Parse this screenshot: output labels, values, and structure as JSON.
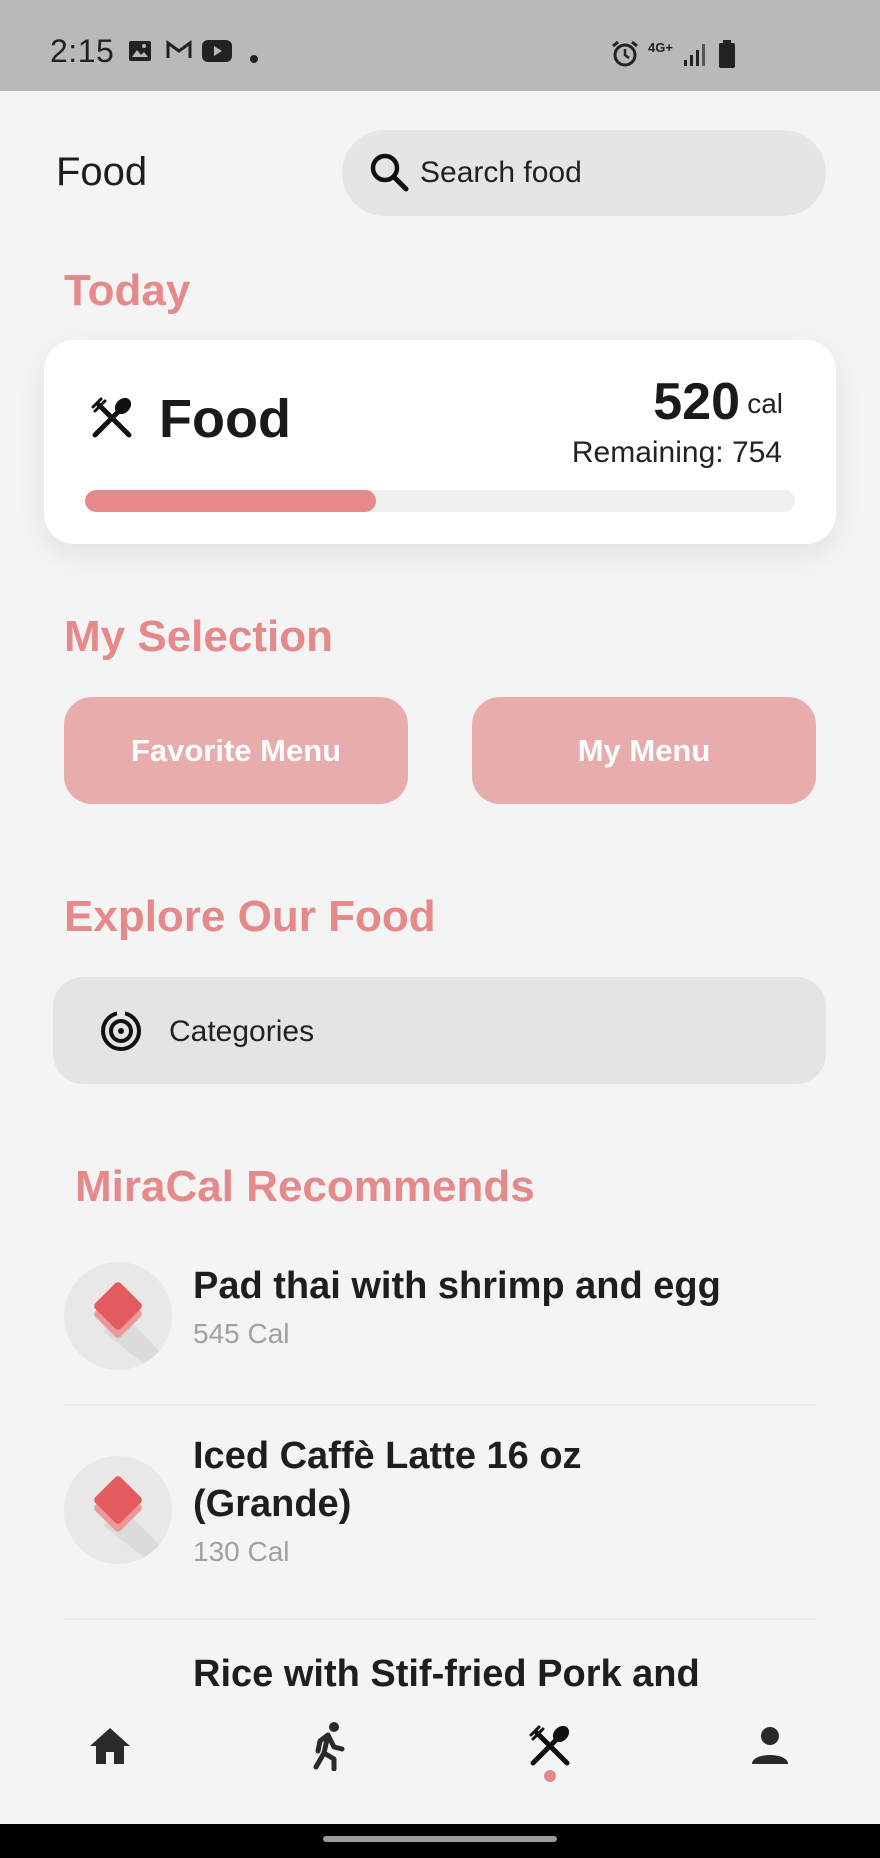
{
  "status_bar": {
    "time": "2:15",
    "left_icons": [
      "image-icon",
      "gmail-icon",
      "youtube-icon",
      "dot-icon"
    ],
    "right_icons": [
      "alarm-icon",
      "4g-icon",
      "signal-icon",
      "battery-icon"
    ],
    "network": "4G+"
  },
  "header": {
    "title": "Food",
    "search_placeholder": "Search food"
  },
  "today": {
    "title": "Today",
    "card": {
      "label": "Food",
      "calories": "520",
      "unit": "cal",
      "remaining": "Remaining: 754",
      "progress_fraction": 0.41
    }
  },
  "my_selection": {
    "title": "My Selection",
    "favorite_label": "Favorite Menu",
    "my_menu_label": "My Menu"
  },
  "explore": {
    "title": "Explore Our Food",
    "categories_label": "Categories"
  },
  "recommends": {
    "title": "MiraCal Recommends",
    "items": [
      {
        "name": "Pad thai with shrimp and egg",
        "calories": "545 Cal"
      },
      {
        "name": "Iced Caffè Latte 16 oz (Grande)",
        "calories": "130 Cal"
      },
      {
        "name": "Rice with Stif-fried Pork and",
        "calories": ""
      }
    ]
  },
  "bottom_nav": {
    "items": [
      "home-icon",
      "run-icon",
      "food-icon",
      "profile-icon"
    ],
    "active": "food-icon"
  },
  "colors": {
    "accent": "#e5898b",
    "button": "#e8acac",
    "background": "#f4f4f4"
  }
}
